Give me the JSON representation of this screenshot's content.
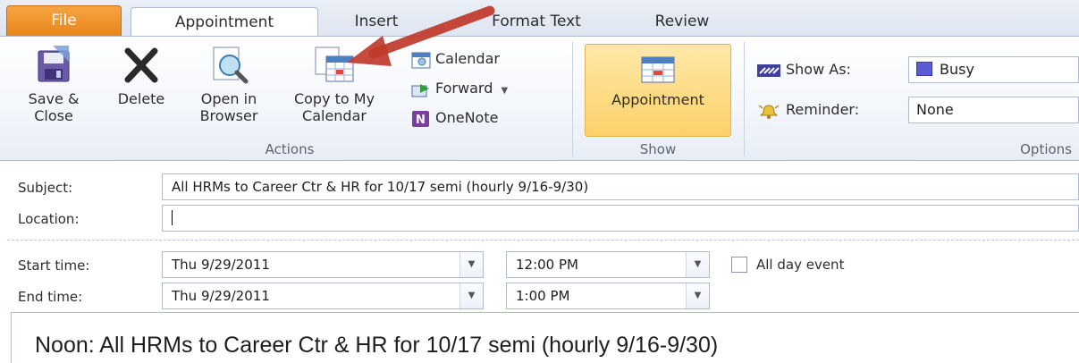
{
  "tabs": {
    "file": "File",
    "appointment": "Appointment",
    "insert": "Insert",
    "format_text": "Format Text",
    "review": "Review"
  },
  "ribbon": {
    "actions": {
      "save_close_line1": "Save &",
      "save_close_line2": "Close",
      "delete": "Delete",
      "open_browser_line1": "Open in",
      "open_browser_line2": "Browser",
      "copy_line1": "Copy to My",
      "copy_line2": "Calendar",
      "calendar": "Calendar",
      "forward": "Forward",
      "onenote": "OneNote",
      "group_label": "Actions"
    },
    "show": {
      "appointment": "Appointment",
      "group_label": "Show"
    },
    "options": {
      "show_as_label": "Show As:",
      "show_as_value": "Busy",
      "reminder_label": "Reminder:",
      "reminder_value": "None",
      "group_label": "Options"
    }
  },
  "form": {
    "subject_label": "Subject:",
    "subject_value": "All HRMs to Career Ctr & HR for 10/17 semi (hourly 9/16-9/30)",
    "location_label": "Location:",
    "location_value": "",
    "start_label": "Start time:",
    "start_date": "Thu 9/29/2011",
    "start_time": "12:00 PM",
    "all_day_label": "All day event",
    "all_day_checked": false,
    "end_label": "End time:",
    "end_date": "Thu 9/29/2011",
    "end_time": "1:00 PM",
    "body_text": "Noon: All HRMs to Career Ctr & HR for 10/17 semi (hourly 9/16-9/30)"
  },
  "colors": {
    "file_tab": "#e8861a",
    "accent_arrow": "#c0392b",
    "busy": "#5b5bd6",
    "ribbon_bg": "#f3f6fb"
  },
  "icons": [
    "save-close-icon",
    "delete-icon",
    "open-in-browser-icon",
    "copy-to-calendar-icon",
    "calendar-small-icon",
    "forward-icon",
    "onenote-icon",
    "appointment-icon",
    "show-as-icon",
    "reminder-icon",
    "dropdown-arrow-icon",
    "annotation-arrow"
  ]
}
